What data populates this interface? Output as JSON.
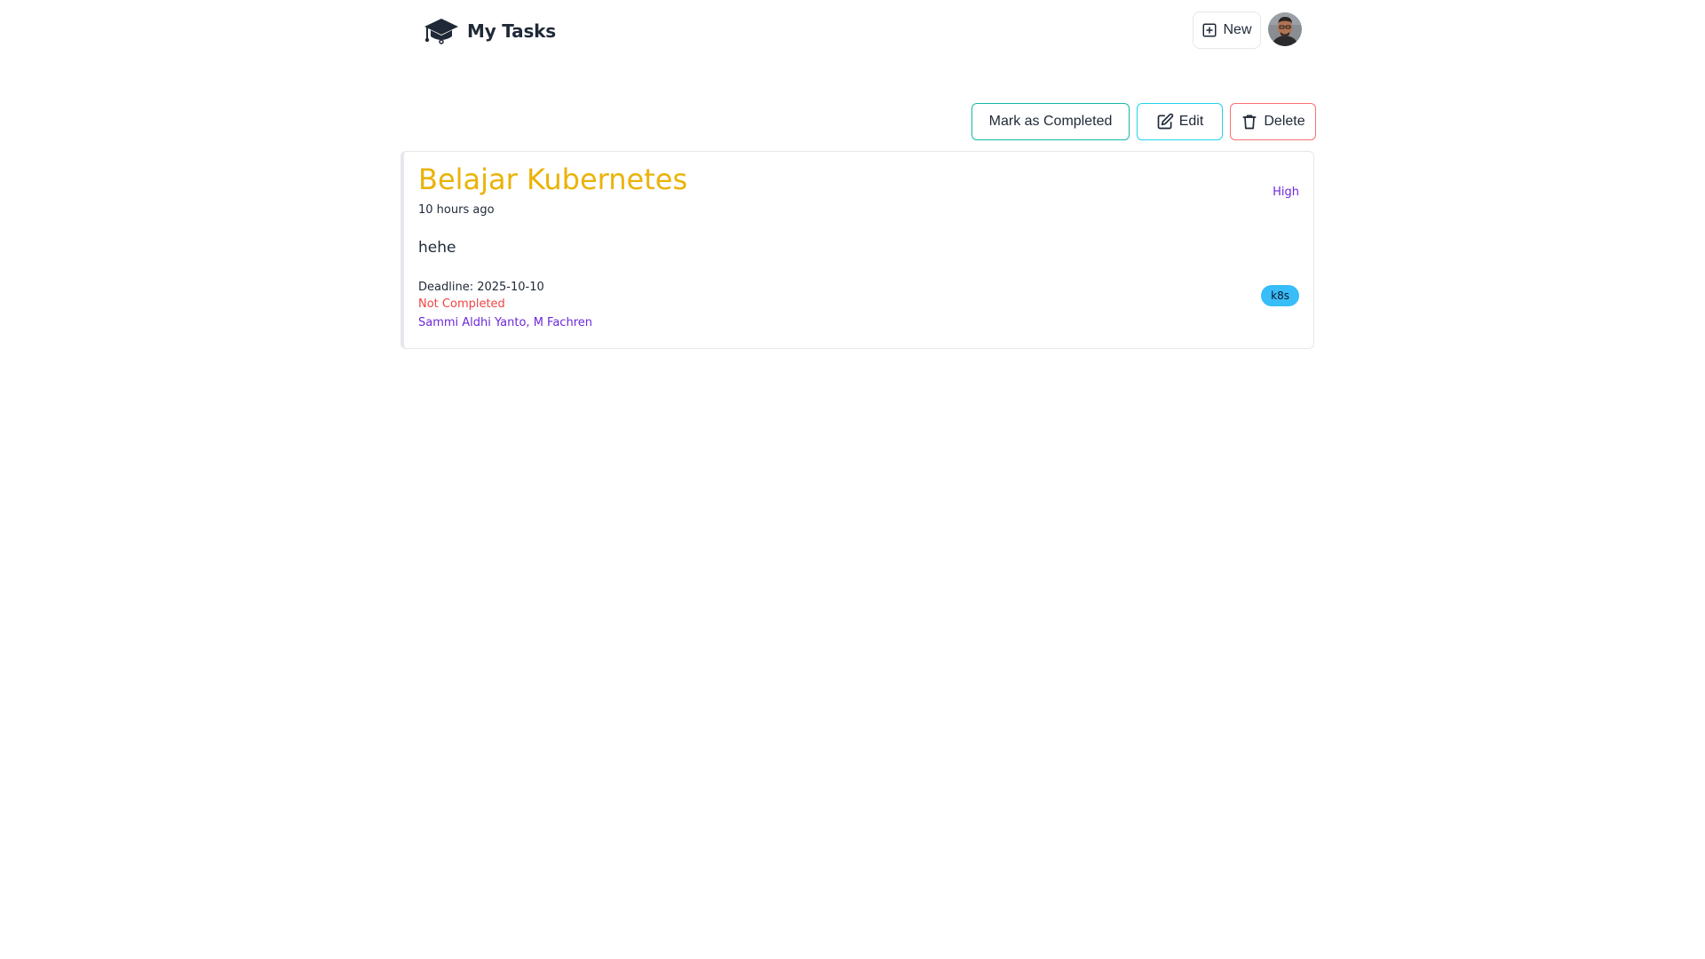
{
  "header": {
    "title": "My Tasks",
    "new_label": "New"
  },
  "actions": {
    "complete_label": "Mark as Completed",
    "edit_label": "Edit",
    "delete_label": "Delete"
  },
  "task": {
    "title": "Belajar Kubernetes",
    "time_ago": "10 hours ago",
    "priority": "High",
    "description": "hehe",
    "deadline": "Deadline: 2025-10-10",
    "status": "Not Completed",
    "assignees": "Sammi Aldhi Yanto, M Fachren",
    "tag": "k8s"
  },
  "colors": {
    "title": "#eab308",
    "priority": "#6d28d9",
    "status": "#ef4444",
    "assignees": "#6d28d9",
    "tag_bg": "#38bdf8",
    "complete_border": "#14b8a6",
    "edit_border": "#22d3ee",
    "delete_border": "#f87171"
  },
  "icons": {
    "logo": "graduation-cap-icon",
    "new": "plus-square-icon",
    "edit": "edit-icon",
    "delete": "trash-icon"
  }
}
